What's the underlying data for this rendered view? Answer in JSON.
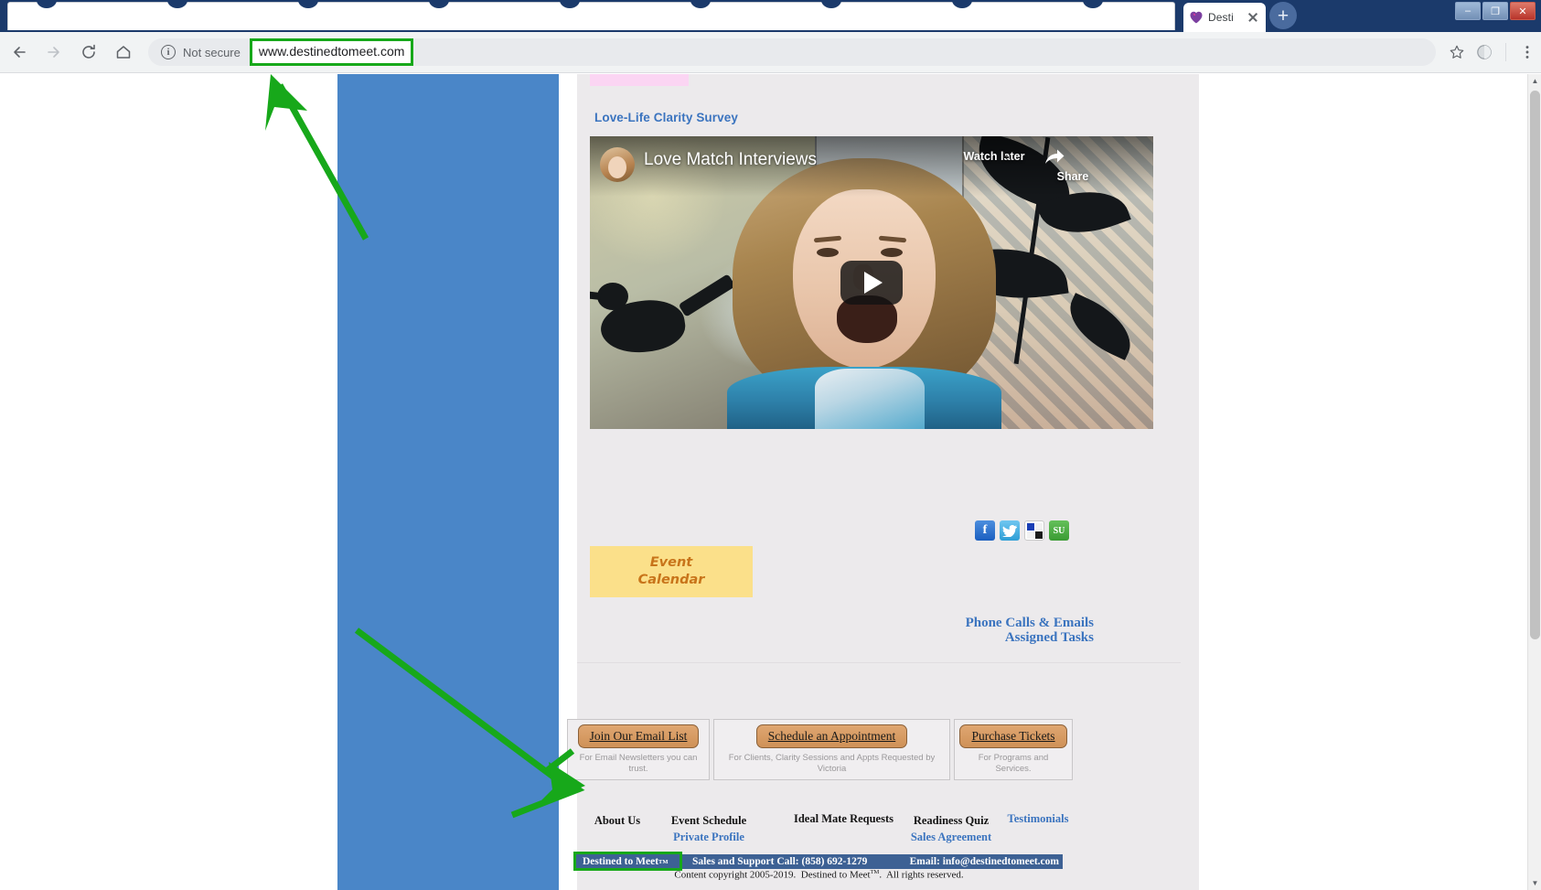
{
  "browser": {
    "tab": {
      "title": "Desti",
      "favicon": "heart-icon"
    },
    "newtab_label": "+",
    "window_controls": {
      "minimize": "–",
      "maximize": "❐",
      "close": "✕"
    },
    "toolbar": {
      "back_icon": "back-arrow-icon",
      "forward_icon": "forward-arrow-icon",
      "reload_icon": "reload-icon",
      "home_icon": "home-icon",
      "security_label": "Not secure",
      "url": "www.destinedtomeet.com",
      "star_icon": "bookmark-star-icon",
      "profile_icon": "profile-icon",
      "menu_icon": "three-dot-menu-icon"
    }
  },
  "page": {
    "survey_link": "Love-Life Clarity Survey",
    "video": {
      "channel_title": "Love Match Interviews",
      "watch_later": "Watch later",
      "share": "Share",
      "play_icon": "play-button-icon"
    },
    "social": [
      {
        "name": "facebook-share-icon",
        "glyph": "f"
      },
      {
        "name": "twitter-share-icon",
        "glyph": "ᴠ"
      },
      {
        "name": "delicious-share-icon",
        "glyph": ""
      },
      {
        "name": "stumbleupon-share-icon",
        "glyph": "SU"
      }
    ],
    "event_calendar": {
      "line1": "Event",
      "line2": "Calendar"
    },
    "right_links": [
      "Phone Calls & Emails",
      "Assigned Tasks"
    ],
    "boxes": [
      {
        "button": "Join Our Email List",
        "caption": "For Email Newsletters you can trust."
      },
      {
        "button": "Schedule an Appointment",
        "caption": "For Clients, Clarity Sessions and Appts Requested by Victoria"
      },
      {
        "button": "Purchase Tickets",
        "caption": "For Programs and Services."
      }
    ],
    "bottom_nav": {
      "about_us": "About Us",
      "event_schedule": "Event Schedule",
      "private_profile": "Private Profile",
      "ideal_mate_requests": "Ideal Mate Requests",
      "readiness_quiz": "Readiness Quiz",
      "sales_agreement": "Sales Agreement",
      "testimonials": "Testimonials"
    },
    "footer": {
      "brand": "Destined to Meet",
      "brand_tm": "TM",
      "phone": "Sales and Support Call: (858) 692-1279",
      "email": "Email: info@destinedtomeet.com",
      "copyright_pre": "Content copyright 2005-2019.  Destined to Meet",
      "copyright_tm": "TM",
      "copyright_post": ".  All rights reserved."
    }
  },
  "annotations": {
    "highlight_color": "#17a81a",
    "arrow_url_target": "www.destinedtomeet.com",
    "arrow_footer_target": "Destined to Meet"
  }
}
